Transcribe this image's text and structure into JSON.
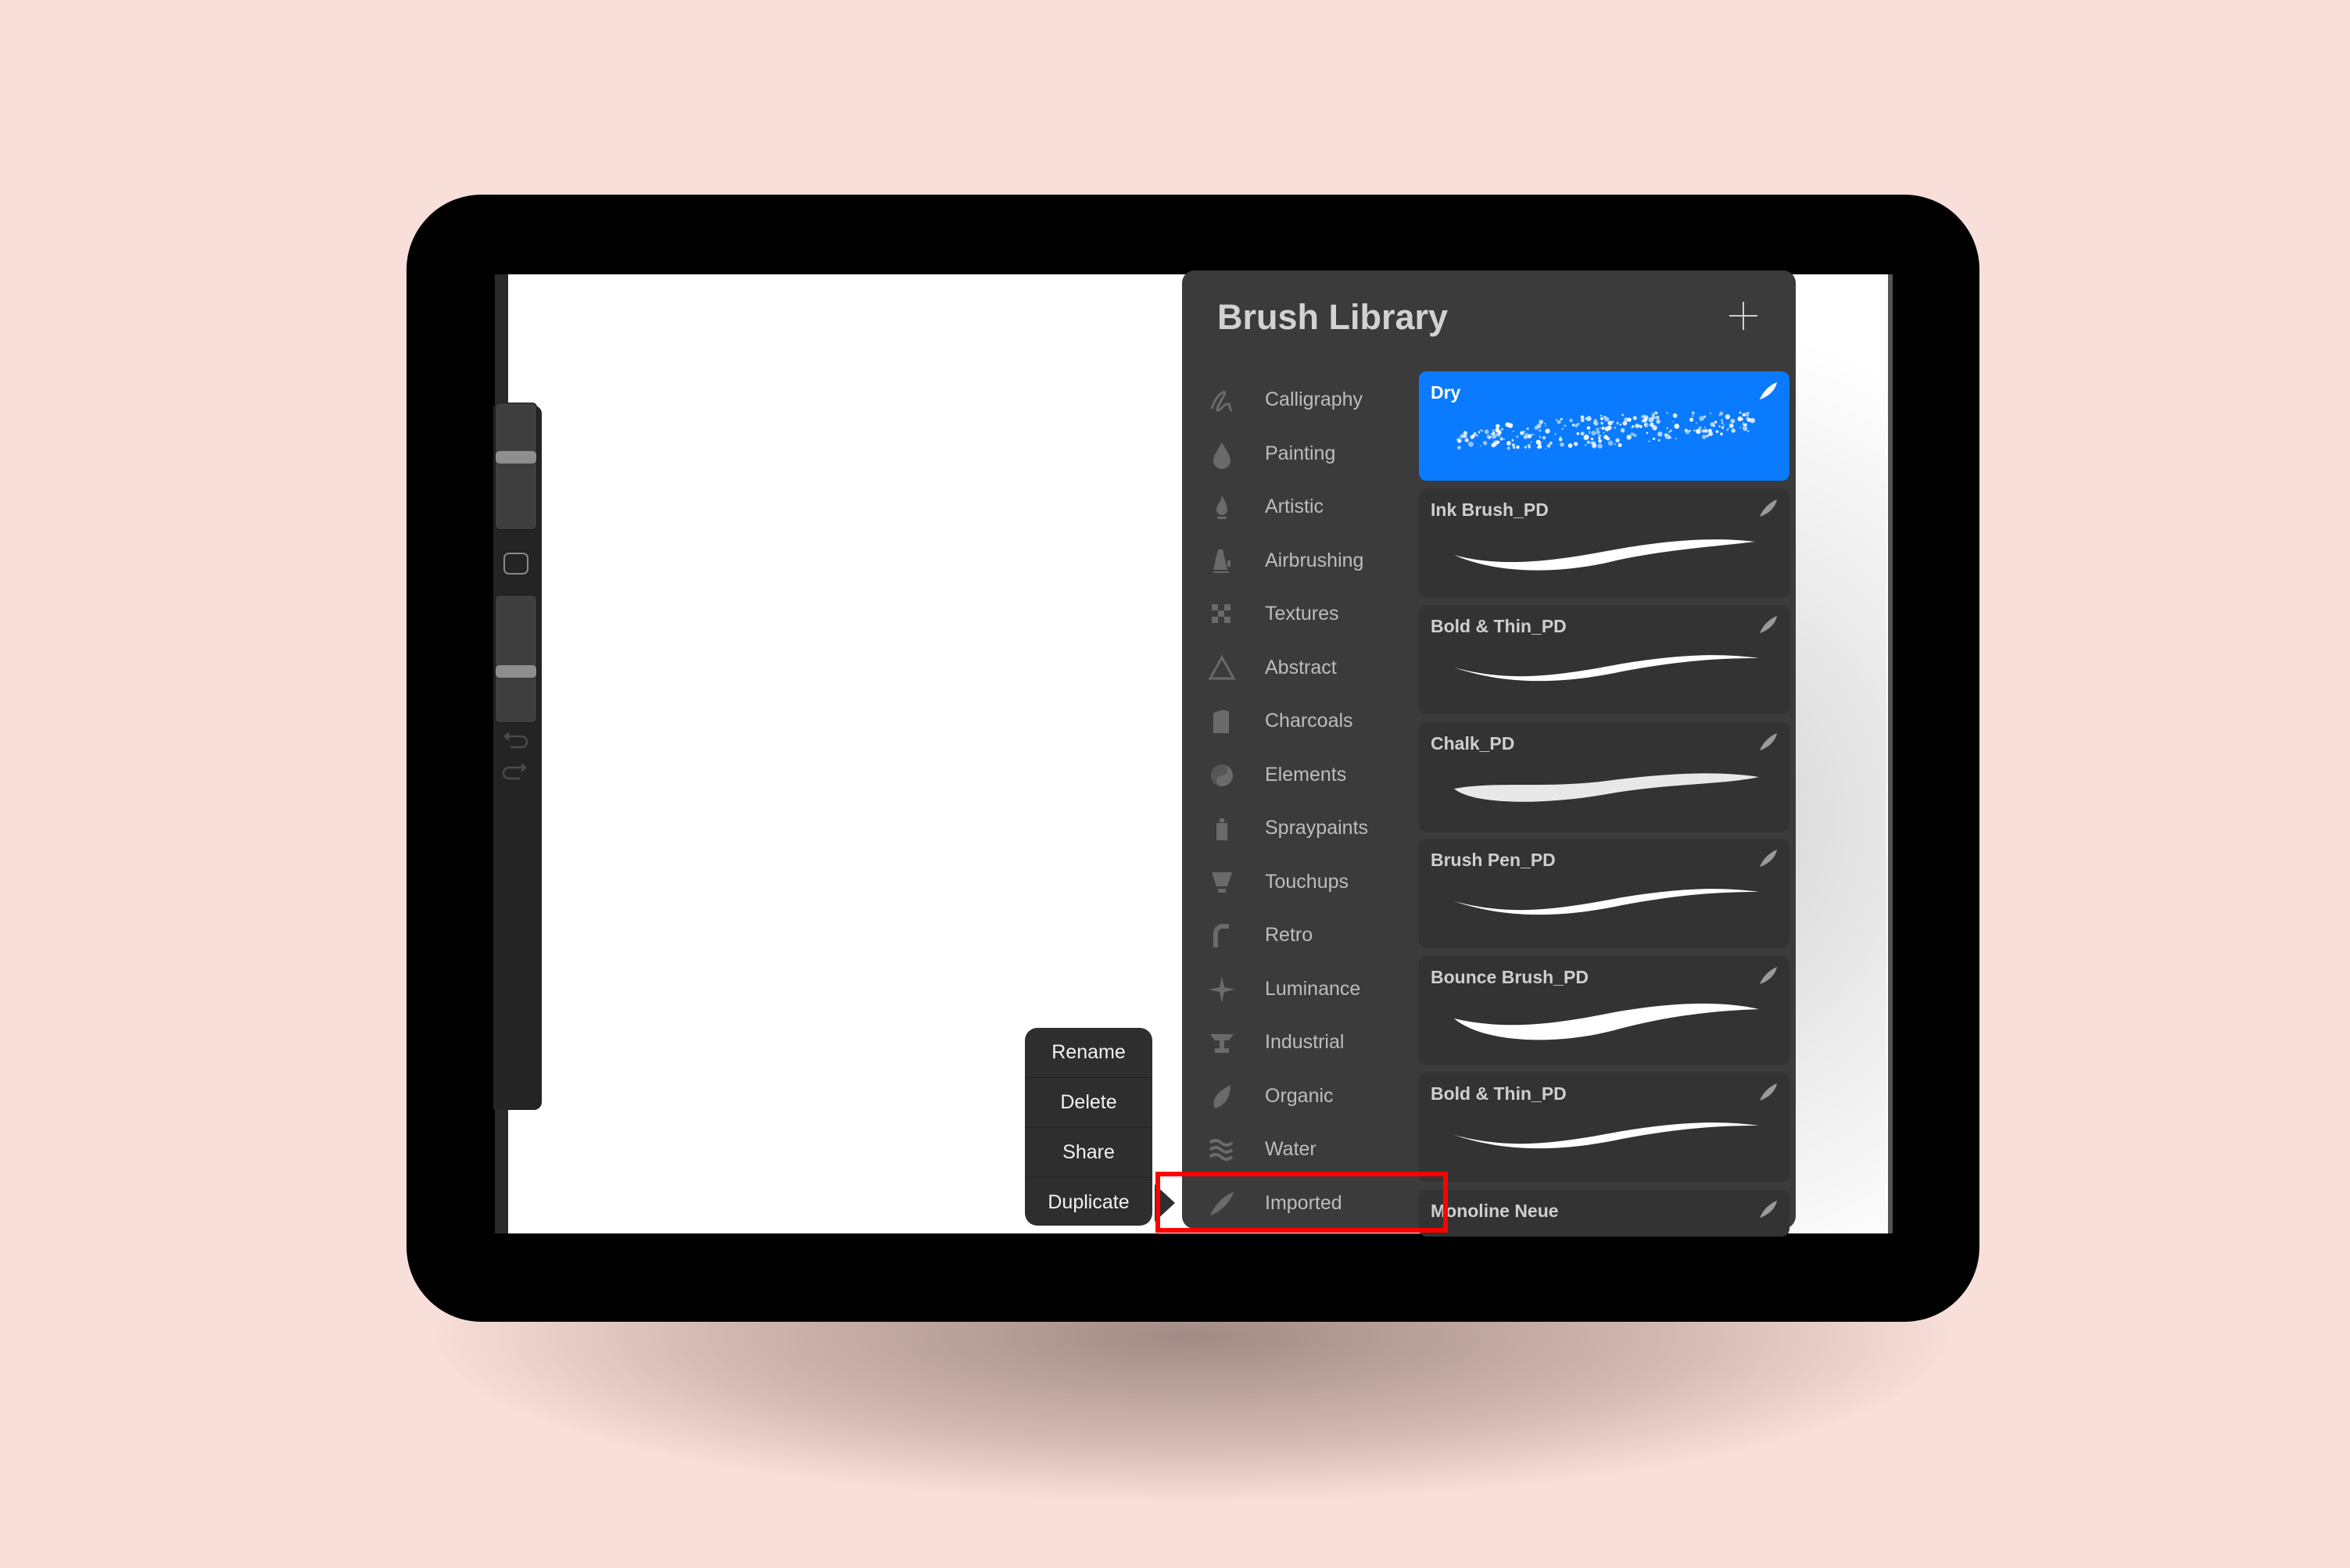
{
  "colors": {
    "background": "#f9dfd9",
    "panel": "#3b3b3b",
    "card": "#333333",
    "selected": "#0a7bff",
    "highlight": "#ff0000"
  },
  "panel": {
    "title": "Brush Library",
    "add_icon": "plus-icon",
    "categories": [
      {
        "label": "Calligraphy",
        "icon": "calligraphy-icon"
      },
      {
        "label": "Painting",
        "icon": "drop-icon"
      },
      {
        "label": "Artistic",
        "icon": "flame-icon"
      },
      {
        "label": "Airbrushing",
        "icon": "airbrush-icon"
      },
      {
        "label": "Textures",
        "icon": "checker-icon"
      },
      {
        "label": "Abstract",
        "icon": "triangle-icon"
      },
      {
        "label": "Charcoals",
        "icon": "charcoal-icon"
      },
      {
        "label": "Elements",
        "icon": "yin-yang-icon"
      },
      {
        "label": "Spraypaints",
        "icon": "spray-can-icon"
      },
      {
        "label": "Touchups",
        "icon": "bulb-icon"
      },
      {
        "label": "Retro",
        "icon": "retro-icon"
      },
      {
        "label": "Luminance",
        "icon": "sparkle-icon"
      },
      {
        "label": "Industrial",
        "icon": "anvil-icon"
      },
      {
        "label": "Organic",
        "icon": "leaf-icon"
      },
      {
        "label": "Water",
        "icon": "waves-icon"
      },
      {
        "label": "Imported",
        "icon": "feather-icon"
      }
    ],
    "brushes": [
      {
        "name": "Dry",
        "selected": true
      },
      {
        "name": "Ink Brush_PD"
      },
      {
        "name": "Bold & Thin_PD"
      },
      {
        "name": "Chalk_PD"
      },
      {
        "name": "Brush Pen_PD"
      },
      {
        "name": "Bounce Brush_PD"
      },
      {
        "name": "Bold & Thin_PD"
      },
      {
        "name": "Monoline Neue"
      }
    ]
  },
  "context_menu": {
    "items": [
      "Rename",
      "Delete",
      "Share",
      "Duplicate"
    ]
  },
  "sidebar": {
    "brush_size_level": 0.57,
    "opacity_level": 0.4
  }
}
